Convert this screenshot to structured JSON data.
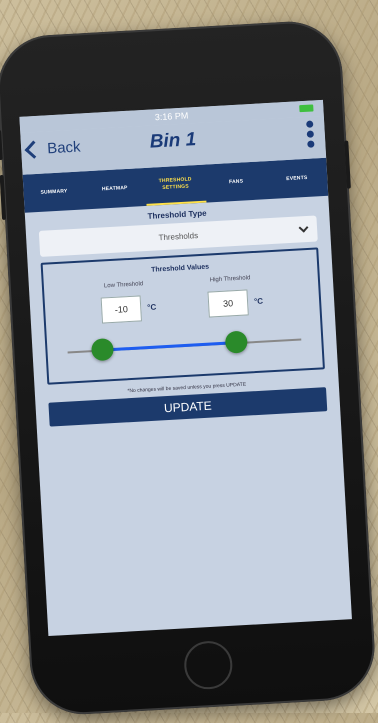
{
  "status": {
    "time": "3:16 PM"
  },
  "nav": {
    "back_label": "Back",
    "title": "Bin 1"
  },
  "tabs": [
    "SUMMARY",
    "HEATMAP",
    "THRESHOLD SETTINGS",
    "FANS",
    "EVENTS"
  ],
  "threshold_type": {
    "heading": "Threshold Type",
    "selected": "Thresholds"
  },
  "threshold_values": {
    "heading": "Threshold Values",
    "low_label": "Low Threshold",
    "low_value": "-10",
    "high_label": "High Threshold",
    "high_value": "30",
    "unit": "°C"
  },
  "note": "*No changes will be saved unless you press UPDATE",
  "update_label": "UPDATE",
  "colors": {
    "accent": "#1c3a6c",
    "active_tab": "#ffe14a",
    "thumb": "#2a8a2a",
    "range": "#1e5df0"
  }
}
